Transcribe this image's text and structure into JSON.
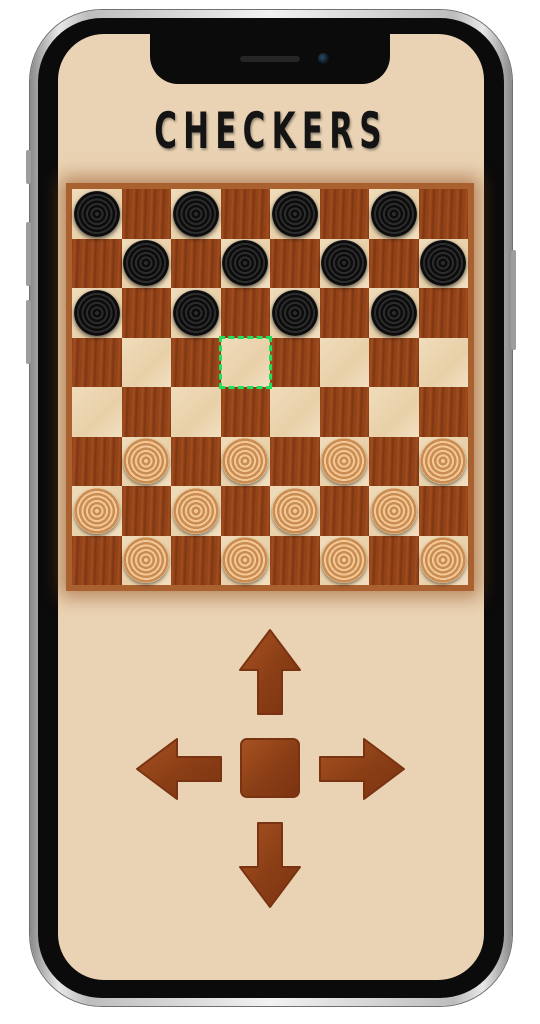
{
  "game": {
    "title": "CHECKERS"
  },
  "board": {
    "size": 8,
    "top_left_square": "light",
    "pieces": [
      {
        "row": 0,
        "col": 0,
        "color": "black"
      },
      {
        "row": 0,
        "col": 2,
        "color": "black"
      },
      {
        "row": 0,
        "col": 4,
        "color": "black"
      },
      {
        "row": 0,
        "col": 6,
        "color": "black"
      },
      {
        "row": 1,
        "col": 1,
        "color": "black"
      },
      {
        "row": 1,
        "col": 3,
        "color": "black"
      },
      {
        "row": 1,
        "col": 5,
        "color": "black"
      },
      {
        "row": 1,
        "col": 7,
        "color": "black"
      },
      {
        "row": 2,
        "col": 0,
        "color": "black"
      },
      {
        "row": 2,
        "col": 2,
        "color": "black"
      },
      {
        "row": 2,
        "col": 4,
        "color": "black"
      },
      {
        "row": 2,
        "col": 6,
        "color": "black"
      },
      {
        "row": 5,
        "col": 1,
        "color": "white"
      },
      {
        "row": 5,
        "col": 3,
        "color": "white"
      },
      {
        "row": 5,
        "col": 5,
        "color": "white"
      },
      {
        "row": 5,
        "col": 7,
        "color": "white"
      },
      {
        "row": 6,
        "col": 0,
        "color": "white"
      },
      {
        "row": 6,
        "col": 2,
        "color": "white"
      },
      {
        "row": 6,
        "col": 4,
        "color": "white"
      },
      {
        "row": 6,
        "col": 6,
        "color": "white"
      },
      {
        "row": 7,
        "col": 1,
        "color": "white"
      },
      {
        "row": 7,
        "col": 3,
        "color": "white"
      },
      {
        "row": 7,
        "col": 5,
        "color": "white"
      },
      {
        "row": 7,
        "col": 7,
        "color": "white"
      }
    ],
    "cursor": {
      "row": 3,
      "col": 3
    }
  },
  "controls": {
    "buttons": [
      "up-arrow",
      "left-arrow",
      "select-square",
      "right-arrow",
      "down-arrow"
    ]
  },
  "colors": {
    "background": "#ead3b4",
    "dark_square": "#9a4a1c",
    "light_square": "#efd9b6",
    "cursor": "#21e05a",
    "control_wood": "#9a4a1c",
    "black_piece": "#111111",
    "white_piece": "#dca06a"
  }
}
